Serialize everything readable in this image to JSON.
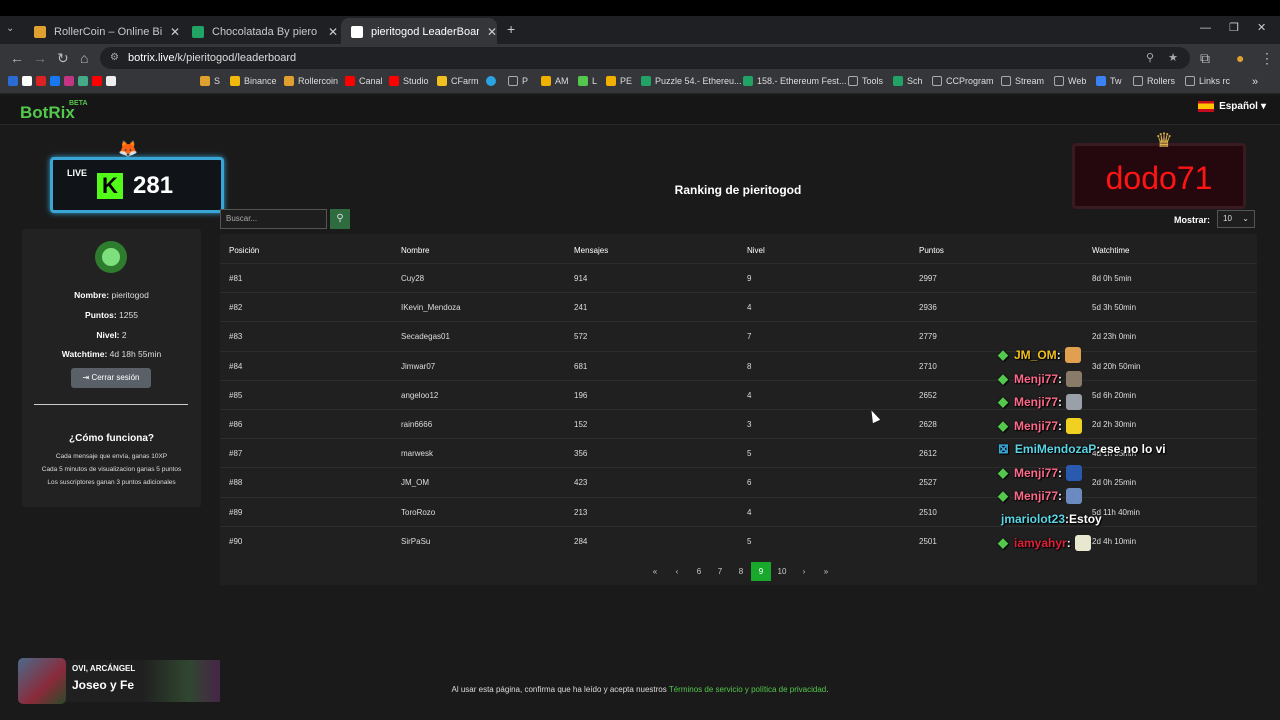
{
  "browser": {
    "tabs": [
      {
        "title": "RollerCoin – Online Bitcoin Mining",
        "color": "#e0a030"
      },
      {
        "title": "Chocolatada By piero edit ronnie",
        "color": "#21a366"
      },
      {
        "title": "pieritogod LeaderBoard | The best",
        "color": "#ffffff"
      }
    ],
    "url_host": "botrix.live",
    "url_path": "/k/pieritogod/leaderboard",
    "bookmarks": [
      "S",
      "Binance",
      "Rollercoin",
      "Canal",
      "Studio",
      "CFarm",
      "P",
      "AM",
      "L",
      "PE",
      "Puzzle 54.- Ethereu...",
      "158.- Ethereum Fest...",
      "Tools",
      "Sch",
      "CCProgram",
      "Stream",
      "Web",
      "Tw",
      "Rollers",
      "Links rc"
    ]
  },
  "nav": {
    "logo": "BotRix",
    "beta": "BETA",
    "language": "Español"
  },
  "live_widget": {
    "label": "LIVE",
    "k": "K",
    "viewers": "281"
  },
  "streamer_widget": {
    "name": "dodo71"
  },
  "sidebar": {
    "nombre_label": "Nombre:",
    "nombre": "pieritogod",
    "puntos_label": "Puntos:",
    "puntos": "1255",
    "nivel_label": "Nivel:",
    "nivel": "2",
    "watchtime_label": "Watchtime:",
    "watchtime": "4d 18h 55min",
    "logout": "Cerrar sesión",
    "how_title": "¿Cómo funciona?",
    "how_lines": [
      "Cada mensaje que envía, ganas 10XP",
      "Cada 5 minutos de visualizacion ganas 5 puntos",
      "Los suscriptores ganan 3 puntos adicionales"
    ]
  },
  "main": {
    "title": "Ranking de pieritogod",
    "search_placeholder": "Buscar...",
    "show_label": "Mostrar:",
    "show_value": "10",
    "columns": [
      "Posición",
      "Nombre",
      "Mensajes",
      "Nivel",
      "Puntos",
      "Watchtime"
    ],
    "rows": [
      [
        "#81",
        "Cuy28",
        "914",
        "9",
        "2997",
        "8d 0h 5min"
      ],
      [
        "#82",
        "IKevin_Mendoza",
        "241",
        "4",
        "2936",
        "5d 3h 50min"
      ],
      [
        "#83",
        "Secadegas01",
        "572",
        "7",
        "2779",
        "2d 23h 0min"
      ],
      [
        "#84",
        "Jimwar07",
        "681",
        "8",
        "2710",
        "3d 20h 50min"
      ],
      [
        "#85",
        "angeloo12",
        "196",
        "4",
        "2652",
        "5d 6h 20min"
      ],
      [
        "#86",
        "rain6666",
        "152",
        "3",
        "2628",
        "2d 2h 30min"
      ],
      [
        "#87",
        "marwesk",
        "356",
        "5",
        "2612",
        "4d 1h 35min"
      ],
      [
        "#88",
        "JM_OM",
        "423",
        "6",
        "2527",
        "2d 0h 25min"
      ],
      [
        "#89",
        "ToroRozo",
        "213",
        "4",
        "2510",
        "5d 11h 40min"
      ],
      [
        "#90",
        "SirPaSu",
        "284",
        "5",
        "2501",
        "2d 4h 10min"
      ]
    ],
    "pages": [
      "«",
      "‹",
      "6",
      "7",
      "8",
      "9",
      "10",
      "›",
      "»"
    ],
    "current_page": "9"
  },
  "chat": [
    {
      "user": "JM_OM",
      "color": "#f0c020",
      "msg": ""
    },
    {
      "user": "Menji77",
      "color": "#ff6a8a",
      "msg": ""
    },
    {
      "user": "Menji77",
      "color": "#ff6a8a",
      "msg": ""
    },
    {
      "user": "Menji77",
      "color": "#ff6a8a",
      "msg": ""
    },
    {
      "user": "EmiMendozaP",
      "color": "#5ad6e6",
      "msg": "ese no lo vi"
    },
    {
      "user": "Menji77",
      "color": "#ff6a8a",
      "msg": ""
    },
    {
      "user": "Menji77",
      "color": "#ff6a8a",
      "msg": ""
    },
    {
      "user": "jmariolot23",
      "color": "#5ad6e6",
      "msg": "Estoy"
    },
    {
      "user": "iamyahyr",
      "color": "#e0203a",
      "msg": ""
    }
  ],
  "song": {
    "artist": "OVI, ARCÁNGEL",
    "title": "Joseo y Fe"
  },
  "footer": {
    "text": "Al usar esta página, confirma que ha leído y acepta nuestros",
    "link": "Términos de servicio y política de privacidad",
    "end": "."
  }
}
